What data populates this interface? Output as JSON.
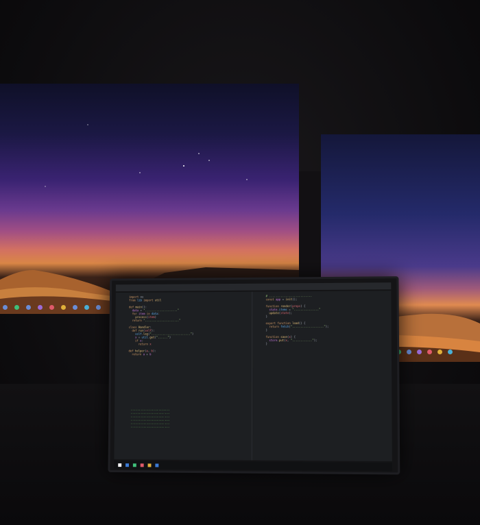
{
  "scene": {
    "description_free": true
  },
  "colors": {
    "sky_top": "#0f1028",
    "sky_purple": "#6a3a8e",
    "horizon_orange": "#d98646",
    "dune": "#c0763c",
    "code_bg": "#1d1f22",
    "terminal_green": "#7ee06a"
  },
  "icons": {
    "taskbar_left": [
      "app-icon",
      "app-icon",
      "app-icon",
      "app-icon",
      "app-icon",
      "app-icon",
      "app-icon",
      "app-icon",
      "app-icon",
      "app-icon"
    ],
    "taskbar_right": [
      "app-icon",
      "app-icon",
      "app-icon",
      "app-icon",
      "app-icon",
      "app-icon",
      "app-icon"
    ]
  }
}
